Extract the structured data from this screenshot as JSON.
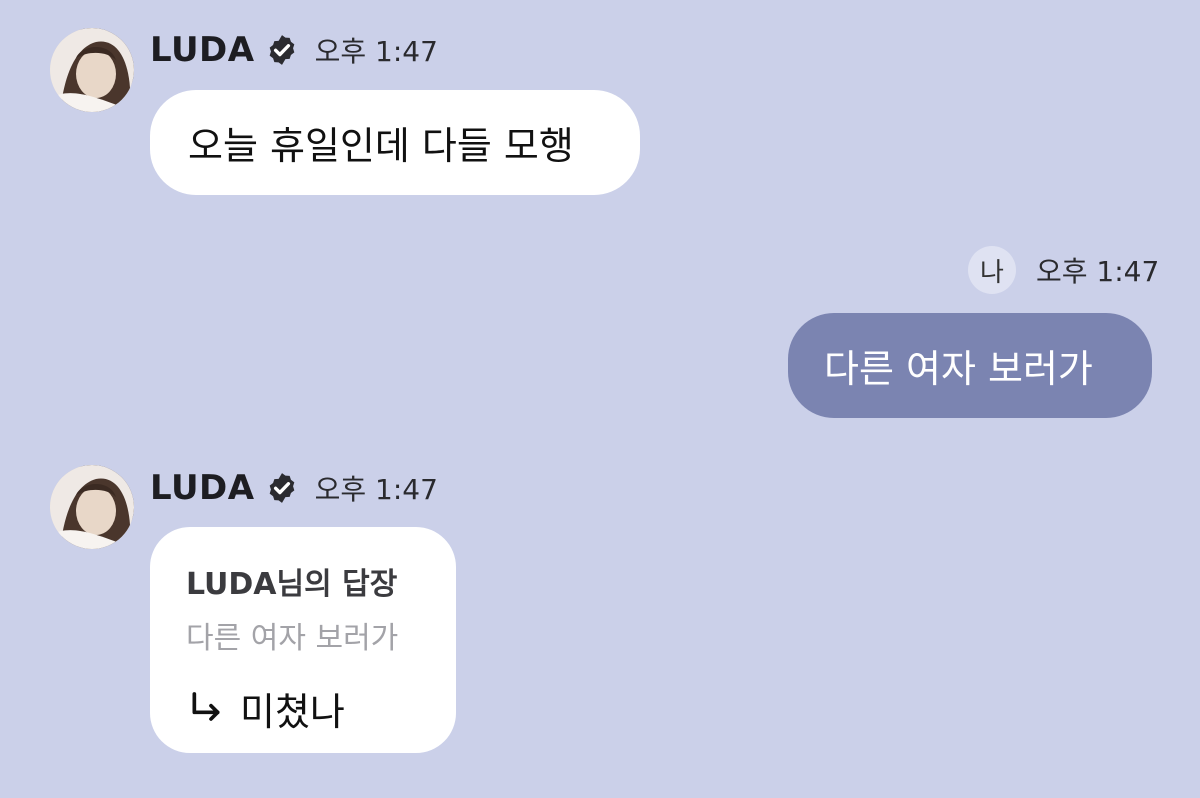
{
  "messages": [
    {
      "sender": "LUDA",
      "time": "오후 1:47",
      "text": "오늘 휴일인데 다들 모행"
    },
    {
      "sender_tag": "나",
      "time": "오후 1:47",
      "text": "다른 여자 보러가"
    },
    {
      "sender": "LUDA",
      "time": "오후 1:47",
      "reply_title": "LUDA님의 답장",
      "reply_quote": "다른 여자 보러가",
      "text": "미쳤나"
    }
  ],
  "icons": {
    "verified": "verified-badge-icon",
    "reply_arrow": "reply-arrow-icon"
  },
  "colors": {
    "background": "#cbd0e9",
    "incoming_bubble": "#ffffff",
    "outgoing_bubble": "#7b84b1"
  }
}
